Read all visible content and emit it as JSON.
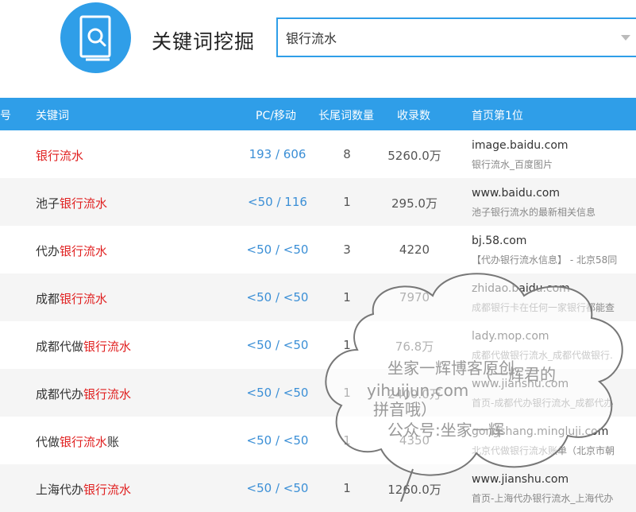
{
  "header": {
    "title": "关键词挖掘",
    "search_value": "银行流水"
  },
  "columns": {
    "index": "号",
    "keyword": "关键词",
    "pc_mobile": "PC/移动",
    "longtail": "长尾词数量",
    "indexed": "收录数",
    "top1": "首页第1位"
  },
  "rows": [
    {
      "pre": "",
      "hl": "银行流水",
      "post": "",
      "pc": "193 / 606",
      "longtail": "8",
      "indexed": "5260.0万",
      "site": "image.baidu.com",
      "desc": "银行流水_百度图片"
    },
    {
      "pre": "池子",
      "hl": "银行流水",
      "post": "",
      "pc": "<50 / 116",
      "longtail": "1",
      "indexed": "295.0万",
      "site": "www.baidu.com",
      "desc": "池子银行流水的最新相关信息"
    },
    {
      "pre": "代办",
      "hl": "银行流水",
      "post": "",
      "pc": "<50 / <50",
      "longtail": "3",
      "indexed": "4220",
      "site": "bj.58.com",
      "desc": "【代办银行流水信息】 - 北京58同"
    },
    {
      "pre": "成都",
      "hl": "银行流水",
      "post": "",
      "pc": "<50 / <50",
      "longtail": "1",
      "indexed": "7970",
      "site": "zhidao.baidu.com",
      "desc": "成都银行卡在任何一家银行都能查"
    },
    {
      "pre": "成都代做",
      "hl": "银行流水",
      "post": "",
      "pc": "<50 / <50",
      "longtail": "1",
      "indexed": "76.8万",
      "site": "lady.mop.com",
      "desc": "成都代做银行流水_成都代做银行."
    },
    {
      "pre": "成都代办",
      "hl": "银行流水",
      "post": "",
      "pc": "<50 / <50",
      "longtail": "1",
      "indexed": "2400.0万",
      "site": "www.jianshu.com",
      "desc": "首页-成都代办银行流水_成都代办"
    },
    {
      "pre": "代做",
      "hl": "银行流水",
      "post": "账",
      "pc": "<50 / <50",
      "longtail": "1",
      "indexed": "4350",
      "site": "gongshang.mingluji.com",
      "desc": "北京代做银行流水账单（北京市朝"
    },
    {
      "pre": "上海代办",
      "hl": "银行流水",
      "post": "",
      "pc": "<50 / <50",
      "longtail": "1",
      "indexed": "1260.0万",
      "site": "www.jianshu.com",
      "desc": "首页-上海代办银行流水_上海代办"
    }
  ],
  "watermark": {
    "line1": "坐家一辉博客原创",
    "line2": "yihuijun.com",
    "line3": "（一辉君的",
    "line4": "拼音哦）",
    "line5": "公众号:坐家一辉"
  },
  "colors": {
    "accent": "#2f9ee8",
    "highlight": "#e02020",
    "link": "#3b8fd6"
  }
}
